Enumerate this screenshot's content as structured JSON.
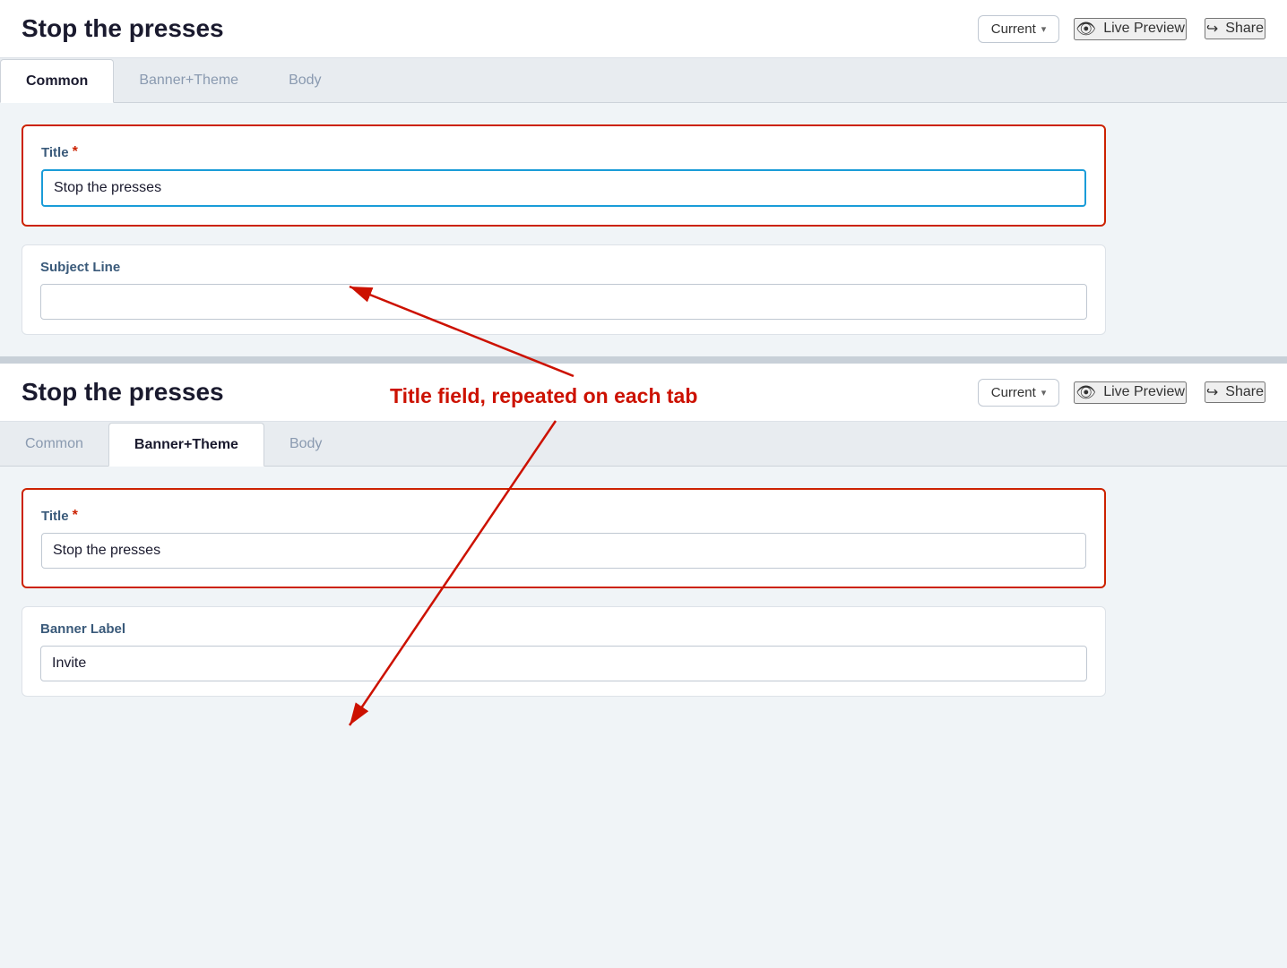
{
  "panel1": {
    "header": {
      "title": "Stop the presses",
      "current_label": "Current",
      "chevron": "▾",
      "live_preview_label": "Live Preview",
      "share_label": "Share"
    },
    "tabs": [
      {
        "id": "common",
        "label": "Common",
        "active": true
      },
      {
        "id": "banner-theme",
        "label": "Banner+Theme",
        "active": false
      },
      {
        "id": "body",
        "label": "Body",
        "active": false
      }
    ],
    "form": {
      "title_label": "Title",
      "title_required": "*",
      "title_value": "Stop the presses",
      "subject_line_label": "Subject Line",
      "subject_line_placeholder": ""
    }
  },
  "annotation": {
    "text": "Title field, repeated on each tab"
  },
  "panel2": {
    "header": {
      "title": "Stop the presses",
      "current_label": "Current",
      "chevron": "▾",
      "live_preview_label": "Live Preview",
      "share_label": "Share"
    },
    "tabs": [
      {
        "id": "common",
        "label": "Common",
        "active": false
      },
      {
        "id": "banner-theme",
        "label": "Banner+Theme",
        "active": true
      },
      {
        "id": "body",
        "label": "Body",
        "active": false
      }
    ],
    "form": {
      "title_label": "Title",
      "title_required": "*",
      "title_value": "Stop the presses",
      "banner_label_label": "Banner Label",
      "banner_label_value": "Invite"
    }
  }
}
